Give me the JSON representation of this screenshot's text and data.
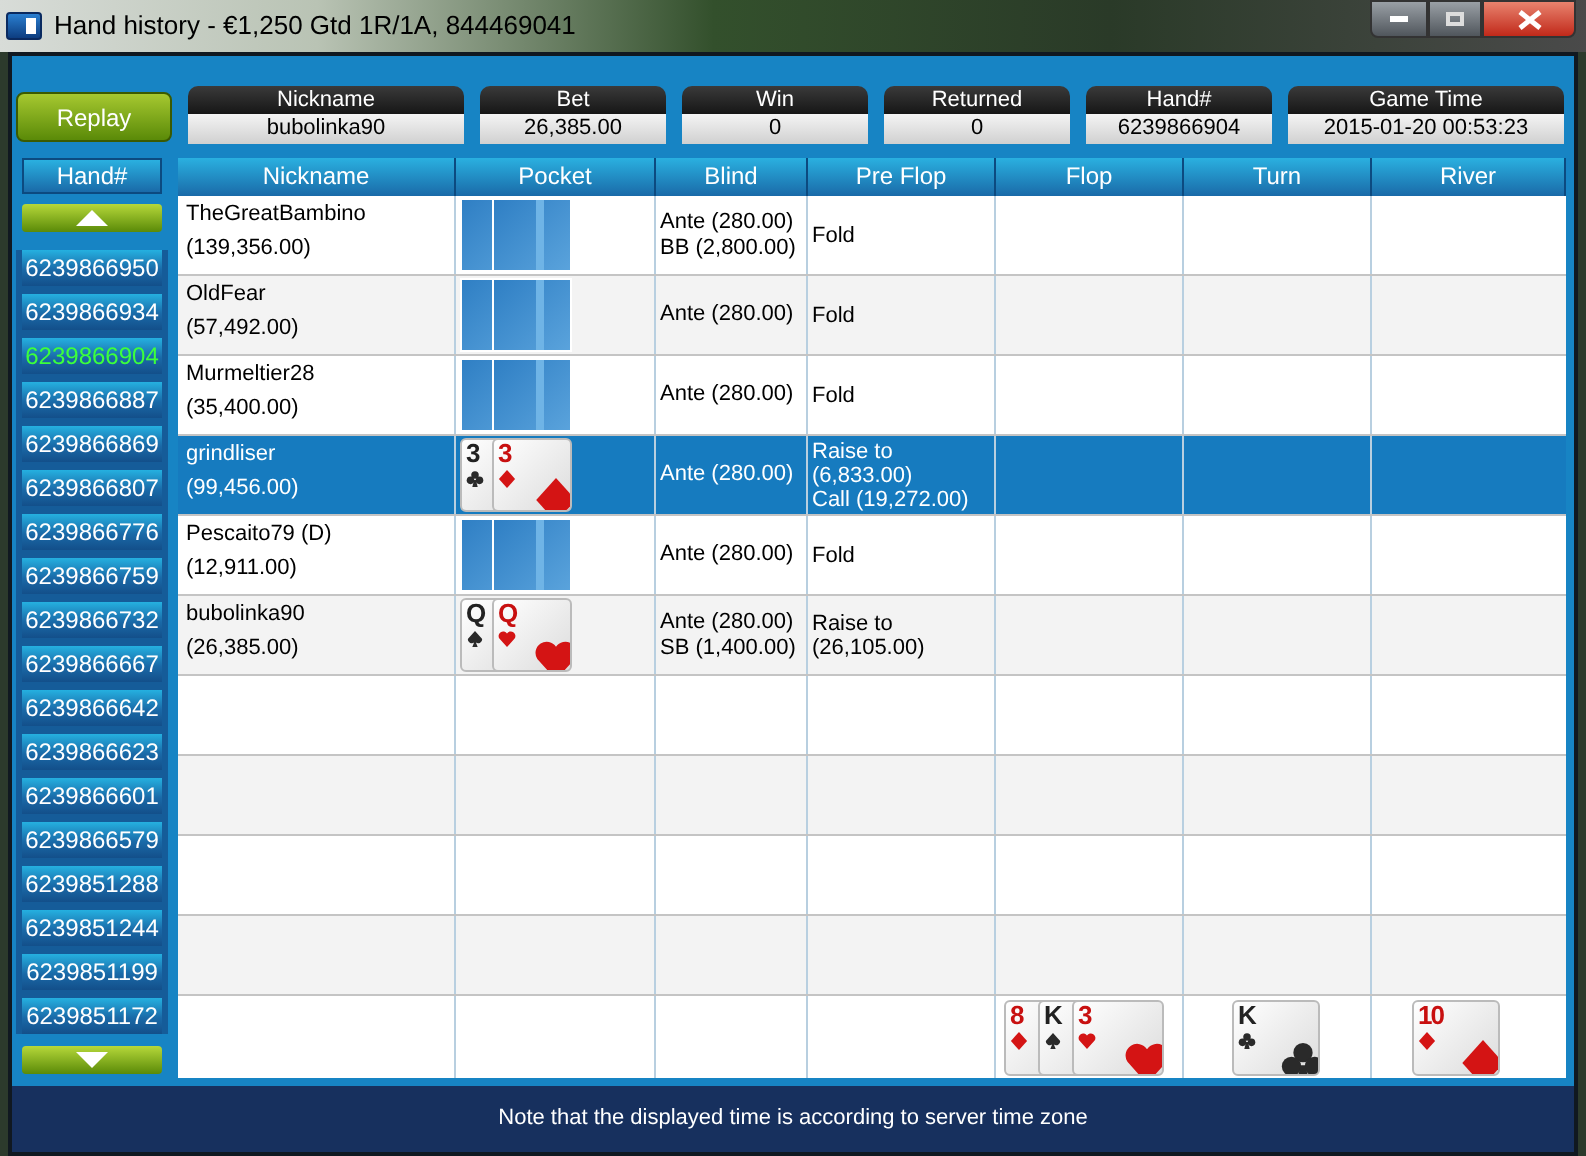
{
  "window": {
    "title": "Hand history - €1,250 Gtd 1R/1A, 844469041"
  },
  "replay_button": "Replay",
  "summary": [
    {
      "label": "Nickname",
      "value": "bubolinka90"
    },
    {
      "label": "Bet",
      "value": "26,385.00"
    },
    {
      "label": "Win",
      "value": "0"
    },
    {
      "label": "Returned",
      "value": "0"
    },
    {
      "label": "Hand#",
      "value": "6239866904"
    },
    {
      "label": "Game Time",
      "value": "2015-01-20 00:53:23"
    }
  ],
  "hand_list": {
    "header": "Hand#",
    "items": [
      {
        "label": "6239866950",
        "selected": false
      },
      {
        "label": "6239866934",
        "selected": false
      },
      {
        "label": "6239866904",
        "selected": true
      },
      {
        "label": "6239866887",
        "selected": false
      },
      {
        "label": "6239866869",
        "selected": false
      },
      {
        "label": "6239866807",
        "selected": false
      },
      {
        "label": "6239866776",
        "selected": false
      },
      {
        "label": "6239866759",
        "selected": false
      },
      {
        "label": "6239866732",
        "selected": false
      },
      {
        "label": "6239866667",
        "selected": false
      },
      {
        "label": "6239866642",
        "selected": false
      },
      {
        "label": "6239866623",
        "selected": false
      },
      {
        "label": "6239866601",
        "selected": false
      },
      {
        "label": "6239866579",
        "selected": false
      },
      {
        "label": "6239851288",
        "selected": false
      },
      {
        "label": "6239851244",
        "selected": false
      },
      {
        "label": "6239851199",
        "selected": false
      },
      {
        "label": "6239851172",
        "selected": false
      }
    ]
  },
  "table": {
    "columns": [
      "Nickname",
      "Pocket",
      "Blind",
      "Pre Flop",
      "Flop",
      "Turn",
      "River"
    ],
    "rows": [
      {
        "nickname": "TheGreatBambino",
        "stack": "(139,356.00)",
        "pocket": [
          {
            "kind": "back"
          },
          {
            "kind": "back"
          }
        ],
        "blind": [
          "Ante (280.00)",
          "BB (2,800.00)"
        ],
        "pre_flop": [
          "Fold"
        ],
        "selected": false
      },
      {
        "nickname": "OldFear",
        "stack": "(57,492.00)",
        "pocket": [
          {
            "kind": "back"
          },
          {
            "kind": "back"
          }
        ],
        "blind": [
          "Ante (280.00)"
        ],
        "pre_flop": [
          "Fold"
        ],
        "selected": false
      },
      {
        "nickname": "Murmeltier28",
        "stack": "(35,400.00)",
        "pocket": [
          {
            "kind": "back"
          },
          {
            "kind": "back"
          }
        ],
        "blind": [
          "Ante (280.00)"
        ],
        "pre_flop": [
          "Fold"
        ],
        "selected": false
      },
      {
        "nickname": "grindliser",
        "stack": "(99,456.00)",
        "pocket": [
          {
            "kind": "club",
            "rank": "3"
          },
          {
            "kind": "diamond",
            "rank": "3"
          }
        ],
        "blind": [
          "Ante (280.00)"
        ],
        "pre_flop": [
          "Raise to (6,833.00)",
          "Call (19,272.00)"
        ],
        "selected": true
      },
      {
        "nickname": "Pescaito79 (D)",
        "stack": "(12,911.00)",
        "pocket": [
          {
            "kind": "back"
          },
          {
            "kind": "back"
          }
        ],
        "blind": [
          "Ante (280.00)"
        ],
        "pre_flop": [
          "Fold"
        ],
        "selected": false
      },
      {
        "nickname": "bubolinka90",
        "stack": "(26,385.00)",
        "pocket": [
          {
            "kind": "spade",
            "rank": "Q"
          },
          {
            "kind": "heart",
            "rank": "Q"
          }
        ],
        "blind": [
          "Ante (280.00)",
          "SB (1,400.00)"
        ],
        "pre_flop": [
          "Raise to (26,105.00)"
        ],
        "selected": false
      }
    ],
    "board": {
      "flop": [
        {
          "kind": "diamond",
          "rank": "8"
        },
        {
          "kind": "spade",
          "rank": "K"
        },
        {
          "kind": "heart",
          "rank": "3"
        }
      ],
      "turn": [
        {
          "kind": "club",
          "rank": "K"
        }
      ],
      "river": [
        {
          "kind": "diamond",
          "rank": "10"
        }
      ]
    }
  },
  "footer": "Note that the displayed time is according to server time zone"
}
